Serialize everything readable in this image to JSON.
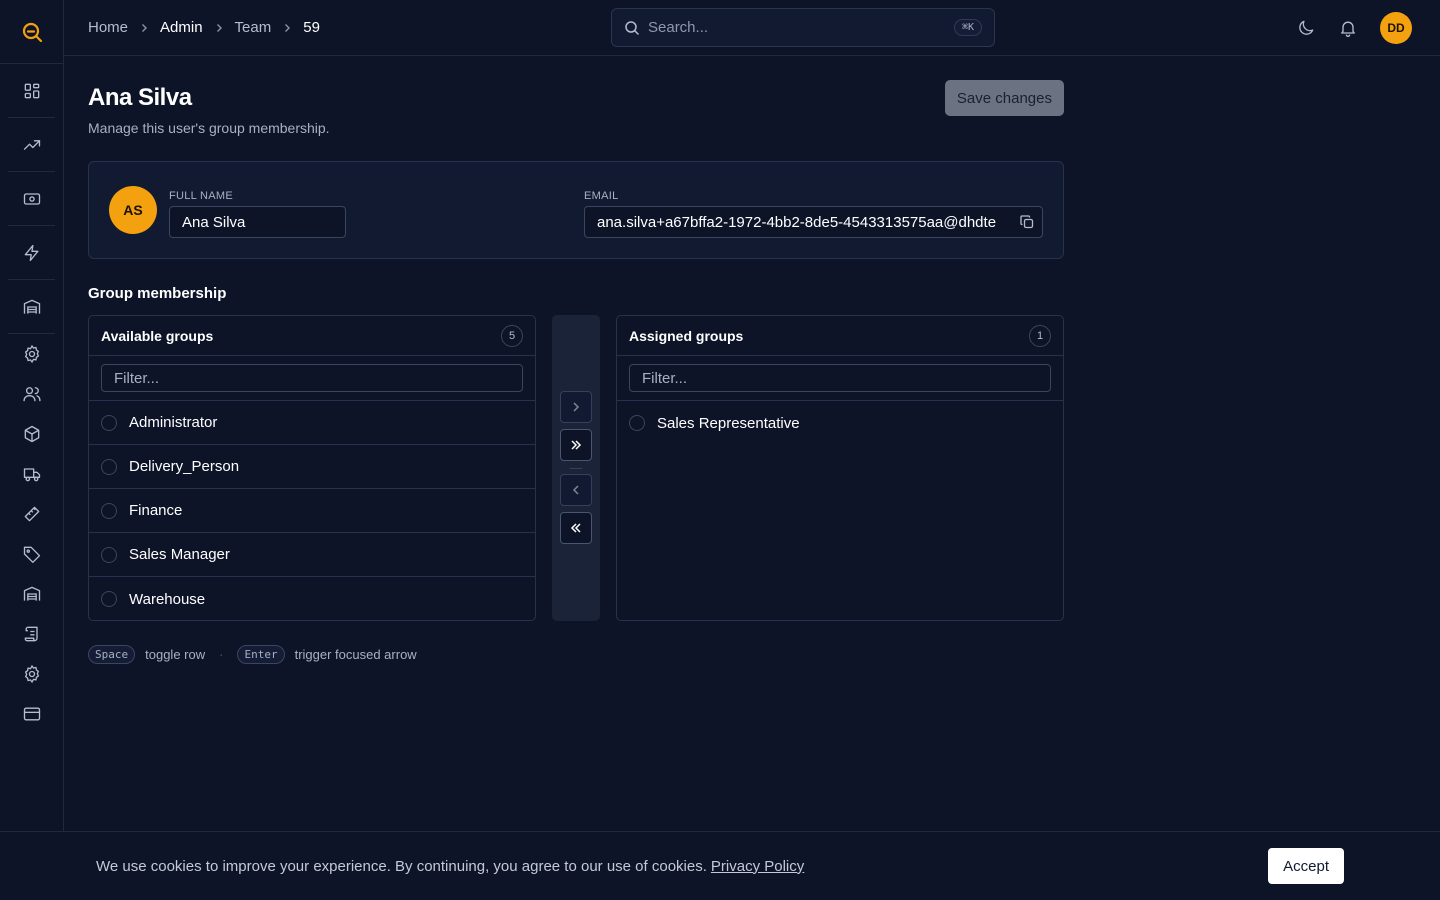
{
  "breadcrumb": {
    "items": [
      "Home",
      "Admin",
      "Team",
      "59"
    ]
  },
  "search": {
    "placeholder": "Search...",
    "shortcut": "⌘K"
  },
  "header": {
    "user_initials": "DD"
  },
  "page": {
    "title": "Ana Silva",
    "subtitle": "Manage this user's group membership.",
    "save_label": "Save changes"
  },
  "user": {
    "initials": "AS",
    "full_name_label": "FULL NAME",
    "full_name": "Ana Silva",
    "email_label": "EMAIL",
    "email": "ana.silva+a67bffa2-1972-4bb2-8de5-4543313575aa@dhdte"
  },
  "membership": {
    "section_title": "Group membership",
    "available": {
      "title": "Available groups",
      "count": "5",
      "filter_placeholder": "Filter...",
      "items": [
        "Administrator",
        "Delivery_Person",
        "Finance",
        "Sales Manager",
        "Warehouse"
      ]
    },
    "assigned": {
      "title": "Assigned groups",
      "count": "1",
      "filter_placeholder": "Filter...",
      "items": [
        "Sales Representative"
      ]
    }
  },
  "hints": {
    "key1": "Space",
    "text1": "toggle row",
    "key2": "Enter",
    "text2": "trigger focused arrow"
  },
  "cookie": {
    "text": "We use cookies to improve your experience. By continuing, you agree to our use of cookies.",
    "link": "Privacy Policy",
    "accept": "Accept"
  },
  "colors": {
    "background": "#0d1428",
    "accent": "#f4a10f",
    "border": "#263150"
  }
}
